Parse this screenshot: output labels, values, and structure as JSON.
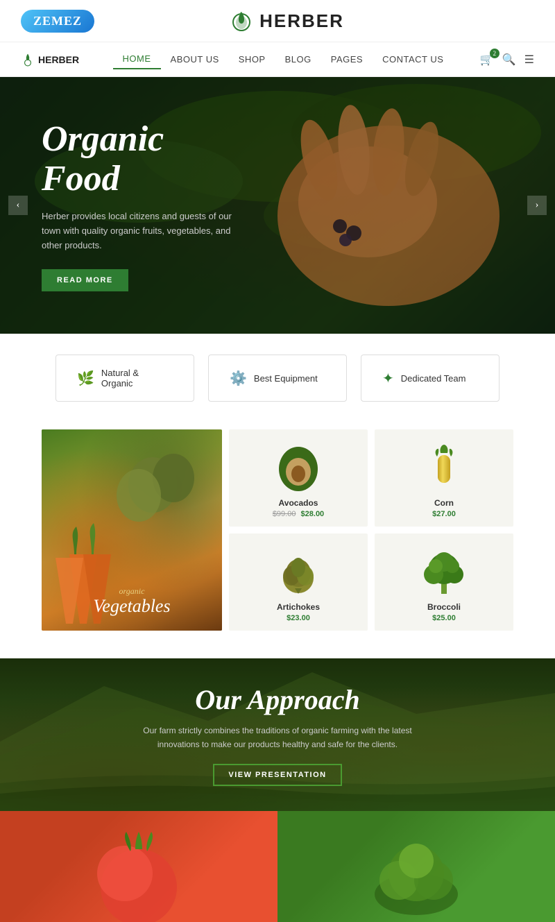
{
  "topbar": {
    "zemez_label": "ZEMEZ",
    "brand_name": "HERBER"
  },
  "nav": {
    "logo_small": "HERBER",
    "items": [
      {
        "label": "HOME",
        "active": true
      },
      {
        "label": "ABOUT US",
        "active": false
      },
      {
        "label": "SHOP",
        "active": false
      },
      {
        "label": "BLOG",
        "active": false
      },
      {
        "label": "PAGES",
        "active": false
      },
      {
        "label": "CONTACT US",
        "active": false
      }
    ],
    "cart_count": "2"
  },
  "hero": {
    "title": "Organic Food",
    "description": "Herber provides local citizens and guests of our town with quality organic fruits, vegetables, and other products.",
    "button_label": "READ MORE",
    "arrow_left": "‹",
    "arrow_right": "›"
  },
  "features": [
    {
      "icon": "🌿",
      "label": "Natural & Organic"
    },
    {
      "icon": "⚙️",
      "label": "Best Equipment"
    },
    {
      "icon": "✦",
      "label": "Dedicated Team"
    }
  ],
  "featured_product": {
    "subtitle": "organic",
    "title": "Vegetables"
  },
  "products": [
    {
      "name": "Avocados",
      "price_old": "$99.00",
      "price_new": "$28.00",
      "type": "avocado"
    },
    {
      "name": "Corn",
      "price_old": null,
      "price_new": "$27.00",
      "type": "corn"
    },
    {
      "name": "Artichokes",
      "price_old": null,
      "price_new": "$23.00",
      "type": "artichoke"
    },
    {
      "name": "Broccoli",
      "price_old": null,
      "price_new": "$25.00",
      "type": "broccoli"
    }
  ],
  "approach": {
    "title": "Our Approach",
    "description": "Our farm strictly combines the traditions of organic farming with the latest innovations to make our products healthy and safe for the clients.",
    "button_label": "VIEW PRESENTATION"
  },
  "colors": {
    "primary_green": "#2e7d32",
    "accent_blue": "#1976d2"
  }
}
